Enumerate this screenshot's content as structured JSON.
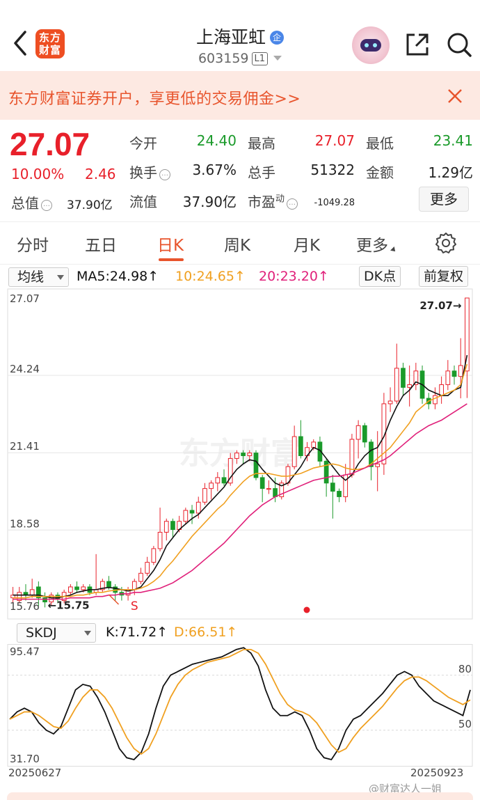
{
  "header": {
    "logo_line1": "东方",
    "logo_line2": "财富",
    "stock_name": "上海亚虹",
    "badge": "企",
    "stock_code": "603159",
    "level": "L1"
  },
  "banner": {
    "text": "东方财富证券开户，享更低的交易佣金>>"
  },
  "quote": {
    "price": "27.07",
    "change_pct": "10.00%",
    "change_amt": "2.46",
    "fields": [
      {
        "label": "今开",
        "value": "24.40",
        "color": "#1a9a2a"
      },
      {
        "label": "最高",
        "value": "27.07",
        "color": "#e8202a"
      },
      {
        "label": "最低",
        "value": "23.41",
        "color": "#1a9a2a"
      },
      {
        "label": "换手",
        "value": "3.67%",
        "color": "#222222"
      },
      {
        "label": "总手",
        "value": "51322",
        "color": "#222222"
      },
      {
        "label": "金额",
        "value": "1.29亿",
        "color": "#222222"
      },
      {
        "label": "流值",
        "value": "37.90亿",
        "color": "#222222"
      },
      {
        "label": "市盈",
        "value": "-1049.28",
        "color": "#222222"
      }
    ],
    "total_label": "总值",
    "total_value": "37.90亿",
    "pe_superscript": "动",
    "more_label": "更多"
  },
  "tabs": [
    {
      "label": "分时"
    },
    {
      "label": "五日"
    },
    {
      "label": "日K"
    },
    {
      "label": "周K"
    },
    {
      "label": "月K"
    },
    {
      "label": "更多"
    }
  ],
  "ma_bar": {
    "selector": "均线",
    "ma5": "MA5:24.98↑",
    "ma10": "10:24.65↑",
    "ma20": "20:23.20↑",
    "dk": "DK点",
    "adjust": "前复权",
    "colors": {
      "ma5": "#111111",
      "ma10": "#f0a020",
      "ma20": "#e0207a"
    }
  },
  "kline": {
    "y_labels": [
      "27.07",
      "24.24",
      "21.41",
      "18.58",
      "15.76"
    ],
    "last_label": "27.07→",
    "low_label": "←15.75",
    "marker_s": "S",
    "watermark": "东方财富",
    "colors": {
      "up": "#e8202a",
      "down": "#1a9a2a"
    }
  },
  "kdj_bar": {
    "selector": "SKDJ",
    "k": "K:71.72↑",
    "d": "D:66.51↑",
    "colors": {
      "k": "#111111",
      "d": "#f0a020"
    }
  },
  "kdj": {
    "y_labels": [
      "95.47",
      "31.70"
    ],
    "levels": [
      "80",
      "50"
    ]
  },
  "dates": {
    "start": "20250627",
    "end": "20250923"
  },
  "watermark": "@财富达人一姐",
  "chart_data": [
    {
      "type": "candlestick",
      "title": "",
      "ylim": [
        15.76,
        27.07
      ],
      "y_ticks": [
        27.07,
        24.24,
        21.41,
        18.58,
        15.76
      ],
      "x_range": [
        "20250627",
        "20250923"
      ],
      "candles": [
        [
          16.1,
          16.2,
          16.5,
          15.9
        ],
        [
          16.0,
          16.3,
          16.5,
          15.9
        ],
        [
          16.3,
          16.2,
          16.6,
          16.0
        ],
        [
          16.2,
          16.4,
          16.8,
          16.1
        ],
        [
          16.5,
          16.1,
          16.7,
          15.8
        ],
        [
          16.1,
          15.95,
          16.3,
          15.75
        ],
        [
          15.95,
          16.2,
          16.3,
          15.8
        ],
        [
          16.2,
          16.05,
          16.3,
          15.9
        ],
        [
          16.0,
          16.3,
          16.4,
          15.9
        ],
        [
          16.3,
          16.5,
          16.6,
          16.2
        ],
        [
          16.5,
          16.4,
          16.7,
          16.3
        ],
        [
          16.4,
          16.5,
          16.6,
          16.3
        ],
        [
          16.5,
          16.3,
          16.6,
          16.2
        ],
        [
          16.3,
          16.4,
          17.7,
          16.2
        ],
        [
          16.4,
          16.7,
          16.8,
          16.3
        ],
        [
          16.7,
          16.5,
          16.9,
          16.4
        ],
        [
          16.5,
          16.3,
          16.6,
          16.0
        ],
        [
          16.3,
          16.2,
          16.5,
          16.0
        ],
        [
          16.2,
          16.4,
          16.5,
          16.0
        ],
        [
          16.4,
          16.7,
          16.8,
          16.2
        ],
        [
          16.7,
          17.0,
          17.2,
          16.6
        ],
        [
          17.0,
          17.4,
          17.6,
          16.9
        ],
        [
          17.4,
          17.9,
          18.0,
          17.3
        ],
        [
          17.9,
          18.5,
          19.4,
          17.8
        ],
        [
          18.5,
          18.9,
          19.0,
          18.2
        ],
        [
          18.9,
          18.6,
          19.0,
          18.3
        ],
        [
          18.6,
          18.9,
          19.1,
          18.5
        ],
        [
          18.9,
          19.3,
          19.4,
          18.8
        ],
        [
          19.3,
          19.2,
          19.5,
          18.8
        ],
        [
          19.2,
          19.6,
          19.8,
          19.0
        ],
        [
          19.6,
          20.1,
          20.3,
          19.5
        ],
        [
          20.1,
          20.3,
          20.4,
          19.7
        ],
        [
          20.3,
          20.5,
          20.7,
          20.0
        ],
        [
          20.5,
          20.3,
          20.8,
          20.2
        ],
        [
          20.3,
          21.2,
          21.4,
          20.2
        ],
        [
          21.2,
          21.4,
          21.5,
          21.0
        ],
        [
          21.4,
          21.3,
          21.5,
          21.0
        ],
        [
          21.3,
          21.4,
          21.5,
          21.1
        ],
        [
          21.4,
          20.5,
          21.5,
          20.4
        ],
        [
          20.5,
          20.1,
          20.6,
          19.6
        ],
        [
          20.1,
          20.1,
          20.4,
          19.9
        ],
        [
          20.1,
          19.8,
          20.5,
          19.6
        ],
        [
          19.8,
          20.3,
          20.4,
          19.7
        ],
        [
          20.3,
          20.9,
          21.0,
          20.2
        ],
        [
          20.9,
          22.0,
          22.4,
          20.8
        ],
        [
          22.0,
          21.3,
          22.6,
          21.2
        ],
        [
          21.3,
          21.6,
          21.8,
          21.1
        ],
        [
          21.6,
          21.8,
          21.9,
          21.5
        ],
        [
          21.8,
          21.1,
          22.0,
          20.9
        ],
        [
          21.1,
          20.3,
          21.2,
          19.8
        ],
        [
          20.3,
          20.0,
          20.6,
          19.0
        ],
        [
          20.0,
          19.8,
          20.1,
          19.6
        ],
        [
          19.8,
          20.6,
          21.0,
          19.6
        ],
        [
          20.6,
          21.9,
          22.1,
          20.5
        ],
        [
          21.9,
          22.4,
          22.6,
          21.2
        ],
        [
          22.4,
          21.8,
          22.5,
          21.6
        ],
        [
          21.8,
          20.9,
          21.9,
          20.4
        ],
        [
          20.9,
          21.0,
          22.2,
          20.0
        ],
        [
          21.0,
          23.2,
          23.6,
          20.6
        ],
        [
          23.2,
          23.3,
          23.8,
          22.9
        ],
        [
          23.3,
          24.5,
          25.4,
          23.2
        ],
        [
          24.5,
          23.8,
          24.7,
          23.5
        ],
        [
          23.8,
          23.9,
          24.6,
          23.1
        ],
        [
          23.9,
          24.4,
          24.7,
          23.7
        ],
        [
          24.4,
          23.4,
          24.6,
          23.2
        ],
        [
          23.4,
          23.2,
          23.6,
          23.0
        ],
        [
          23.2,
          23.5,
          23.8,
          23.0
        ],
        [
          23.5,
          23.9,
          24.2,
          23.2
        ],
        [
          23.9,
          24.4,
          24.8,
          23.7
        ],
        [
          24.4,
          24.2,
          24.6,
          23.9
        ],
        [
          24.2,
          24.6,
          25.6,
          23.4
        ],
        [
          24.4,
          27.07,
          27.07,
          23.41
        ]
      ],
      "series": [
        {
          "name": "MA5",
          "values": [
            16.2,
            16.2,
            16.2,
            16.2,
            16.2,
            16.15,
            16.1,
            16.1,
            16.15,
            16.2,
            16.3,
            16.35,
            16.4,
            16.4,
            16.45,
            16.48,
            16.45,
            16.4,
            16.35,
            16.4,
            16.5,
            16.8,
            17.1,
            17.5,
            18.0,
            18.3,
            18.6,
            18.8,
            19.0,
            19.15,
            19.4,
            19.65,
            19.9,
            20.15,
            20.5,
            20.8,
            21.0,
            21.15,
            21.1,
            20.8,
            20.55,
            20.3,
            20.2,
            20.3,
            20.6,
            20.9,
            21.3,
            21.6,
            21.5,
            21.2,
            20.9,
            20.6,
            20.4,
            20.6,
            21.0,
            21.3,
            21.5,
            21.6,
            22.0,
            22.6,
            23.1,
            23.5,
            23.7,
            24.0,
            23.9,
            23.7,
            23.6,
            23.5,
            23.5,
            23.7,
            23.8,
            24.98
          ]
        },
        {
          "name": "MA10",
          "values": [
            16.1,
            16.1,
            16.1,
            16.15,
            16.15,
            16.15,
            16.15,
            16.15,
            16.15,
            16.15,
            16.2,
            16.2,
            16.25,
            16.3,
            16.3,
            16.35,
            16.38,
            16.4,
            16.4,
            16.4,
            16.45,
            16.55,
            16.7,
            16.9,
            17.2,
            17.45,
            17.75,
            18.05,
            18.35,
            18.6,
            18.85,
            19.1,
            19.35,
            19.55,
            19.85,
            20.1,
            20.35,
            20.55,
            20.65,
            20.65,
            20.65,
            20.6,
            20.55,
            20.55,
            20.6,
            20.65,
            20.75,
            20.85,
            20.9,
            20.95,
            21.0,
            20.95,
            20.85,
            20.8,
            20.8,
            20.85,
            21.0,
            21.2,
            21.4,
            21.6,
            21.9,
            22.2,
            22.5,
            22.9,
            23.1,
            23.3,
            23.4,
            23.5,
            23.6,
            23.7,
            23.9,
            24.65
          ]
        },
        {
          "name": "MA20",
          "values": [
            16.05,
            16.05,
            16.05,
            16.05,
            16.05,
            16.05,
            16.05,
            16.05,
            16.05,
            16.1,
            16.1,
            16.1,
            16.1,
            16.15,
            16.15,
            16.2,
            16.2,
            16.25,
            16.25,
            16.3,
            16.3,
            16.35,
            16.4,
            16.45,
            16.55,
            16.65,
            16.8,
            16.95,
            17.1,
            17.3,
            17.5,
            17.7,
            17.9,
            18.1,
            18.35,
            18.6,
            18.85,
            19.1,
            19.3,
            19.5,
            19.65,
            19.8,
            19.9,
            20.0,
            20.1,
            20.2,
            20.3,
            20.4,
            20.45,
            20.5,
            20.55,
            20.55,
            20.6,
            20.65,
            20.75,
            20.85,
            20.95,
            21.05,
            21.15,
            21.3,
            21.5,
            21.7,
            21.9,
            22.1,
            22.25,
            22.4,
            22.5,
            22.6,
            22.75,
            22.9,
            23.05,
            23.2
          ]
        }
      ]
    },
    {
      "type": "line",
      "title": "",
      "ylim": [
        31.7,
        95.47
      ],
      "y_ticks": [
        95.47,
        31.7
      ],
      "reference_lines": [
        80,
        50
      ],
      "series": [
        {
          "name": "K",
          "values": [
            56,
            60,
            62,
            60,
            54,
            50,
            48,
            52,
            62,
            72,
            75,
            74,
            68,
            60,
            50,
            40,
            35,
            34,
            38,
            48,
            62,
            74,
            80,
            82,
            84,
            86,
            87,
            88,
            89,
            90,
            92,
            94,
            95,
            92,
            85,
            72,
            62,
            58,
            58,
            60,
            58,
            50,
            40,
            35,
            34,
            40,
            50,
            56,
            58,
            62,
            66,
            70,
            75,
            80,
            82,
            80,
            74,
            70,
            66,
            64,
            62,
            60,
            58,
            72
          ]
        },
        {
          "name": "D",
          "values": [
            56,
            58,
            60,
            60,
            58,
            55,
            52,
            51,
            55,
            62,
            68,
            72,
            72,
            68,
            62,
            54,
            46,
            40,
            37,
            40,
            48,
            58,
            68,
            75,
            80,
            83,
            85,
            87,
            88,
            89,
            90,
            92,
            94,
            94,
            92,
            86,
            78,
            70,
            64,
            61,
            60,
            58,
            54,
            48,
            42,
            38,
            40,
            46,
            51,
            55,
            59,
            63,
            68,
            73,
            77,
            79,
            79,
            77,
            74,
            71,
            68,
            66,
            64,
            66.51
          ]
        }
      ]
    }
  ]
}
